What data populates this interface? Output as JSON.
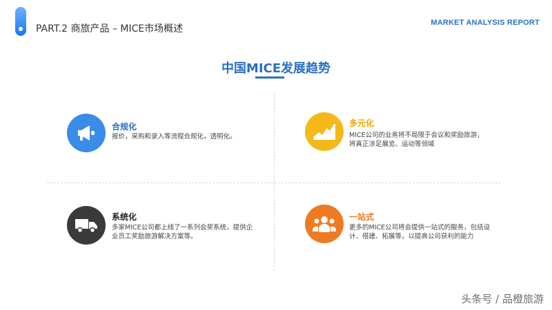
{
  "header": {
    "title": "PART.2 商旅产品 – MICE市场概述",
    "report_label": "MARKET ANALYSIS REPORT"
  },
  "main": {
    "title": "中国MICE发展趋势"
  },
  "items": [
    {
      "title": "合规化",
      "description": "报价，采购和录入等流程合规化，透明化。",
      "icon": "megaphone-icon",
      "color": "#3b8be8"
    },
    {
      "title": "多元化",
      "description": "MICE公司的业务将不局限于会议和奖励旅游，将真正涉足展览、运动等领域",
      "icon": "rising-chart-icon",
      "color": "#f5b81a"
    },
    {
      "title": "系统化",
      "description": "多家MICE公司都上线了一系列会奖系统，提供企业员工奖励旅游解决方案等。",
      "icon": "truck-icon",
      "color": "#3a3a3a"
    },
    {
      "title": "一站式",
      "description": "更多的MICE公司将会提供一站式的服务，包括设计、搭建、拓展等，以提高公司获利的能力",
      "icon": "people-icon",
      "color": "#ee7a22"
    }
  ],
  "watermark": "头条号 / 品橙旅游"
}
